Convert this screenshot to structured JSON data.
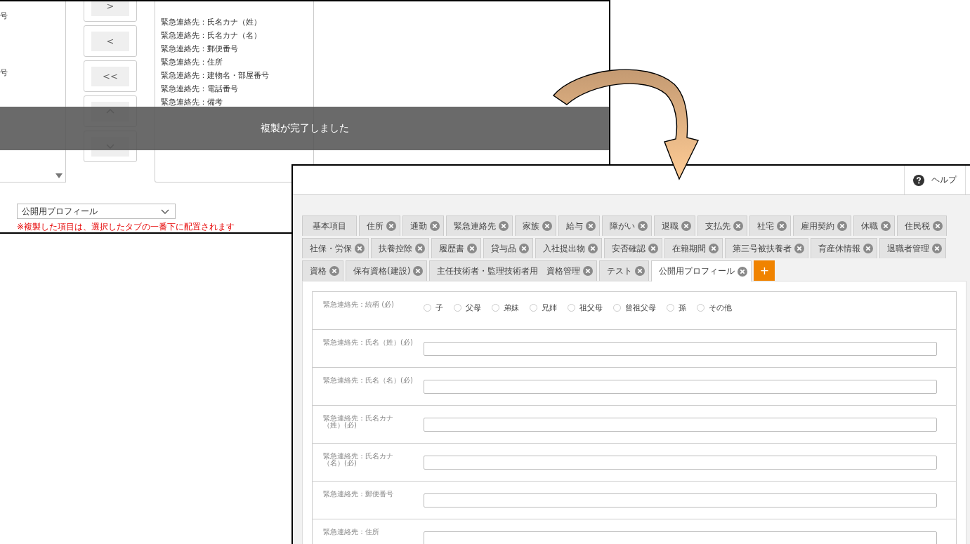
{
  "copy_window": {
    "source_list": {
      "items": [
        "号",
        "号"
      ]
    },
    "move_buttons": [
      {
        "kind": "text",
        "label": ">"
      },
      {
        "kind": "text",
        "label": "<"
      },
      {
        "kind": "text",
        "label": "<<"
      },
      {
        "kind": "up"
      },
      {
        "kind": "down"
      }
    ],
    "target_list": {
      "items": [
        "緊急連絡先：氏名カナ（姓）",
        "緊急連絡先：氏名カナ（名）",
        "緊急連絡先：郵便番号",
        "緊急連絡先：住所",
        "緊急連絡先：建物名・部屋番号",
        "緊急連絡先：電話番号",
        "緊急連絡先：備考"
      ]
    },
    "target_tab_select": {
      "value": "公開用プロフィール"
    },
    "note": "※複製した項目は、選択したタブの一番下に配置されます",
    "toast": {
      "message": "複製が完了しました"
    }
  },
  "form_window": {
    "help": "ヘルプ",
    "tab_rows": [
      [
        {
          "label": "基本項目",
          "closable": false,
          "selected": false
        },
        {
          "label": "住所",
          "closable": true,
          "selected": false
        },
        {
          "label": "通勤",
          "closable": true,
          "selected": false
        },
        {
          "label": "緊急連絡先",
          "closable": true,
          "selected": false
        },
        {
          "label": "家族",
          "closable": true,
          "selected": false
        },
        {
          "label": "給与",
          "closable": true,
          "selected": false
        },
        {
          "label": "障がい",
          "closable": true,
          "selected": false
        },
        {
          "label": "退職",
          "closable": true,
          "selected": false
        },
        {
          "label": "支払先",
          "closable": true,
          "selected": false
        },
        {
          "label": "社宅",
          "closable": true,
          "selected": false
        },
        {
          "label": "雇用契約",
          "closable": true,
          "selected": false
        },
        {
          "label": "休職",
          "closable": true,
          "selected": false
        },
        {
          "label": "住民税",
          "closable": true,
          "selected": false
        }
      ],
      [
        {
          "label": "社保・労保",
          "closable": true,
          "selected": false
        },
        {
          "label": "扶養控除",
          "closable": true,
          "selected": false
        },
        {
          "label": "履歴書",
          "closable": true,
          "selected": false
        },
        {
          "label": "貸与品",
          "closable": true,
          "selected": false
        },
        {
          "label": "入社提出物",
          "closable": true,
          "selected": false
        },
        {
          "label": "安否確認",
          "closable": true,
          "selected": false
        },
        {
          "label": "在籍期間",
          "closable": true,
          "selected": false
        },
        {
          "label": "第三号被扶養者",
          "closable": true,
          "selected": false
        },
        {
          "label": "育産休情報",
          "closable": true,
          "selected": false
        },
        {
          "label": "退職者管理",
          "closable": true,
          "selected": false
        }
      ],
      [
        {
          "label": "資格",
          "closable": true,
          "selected": false
        },
        {
          "label": "保有資格(建設)",
          "closable": true,
          "selected": false
        },
        {
          "label": "主任技術者・監理技術者用　資格管理",
          "closable": true,
          "selected": false
        },
        {
          "label": "テスト",
          "closable": true,
          "selected": false
        },
        {
          "label": "公開用プロフィール",
          "closable": true,
          "selected": true
        }
      ]
    ],
    "add_tab": "+",
    "fields": [
      {
        "kind": "radio",
        "label": "緊急連絡先：続柄 (必)",
        "options": [
          {
            "label": "子",
            "selected": false
          },
          {
            "label": "父母",
            "selected": false
          },
          {
            "label": "弟妹",
            "selected": false
          },
          {
            "label": "兄姉",
            "selected": false
          },
          {
            "label": "祖父母",
            "selected": false
          },
          {
            "label": "曾祖父母",
            "selected": false
          },
          {
            "label": "孫",
            "selected": false
          },
          {
            "label": "その他",
            "selected": false
          }
        ]
      },
      {
        "kind": "text",
        "label": "緊急連絡先：氏名（姓）(必)"
      },
      {
        "kind": "text",
        "label": "緊急連絡先：氏名（名）(必)"
      },
      {
        "kind": "text",
        "label": "緊急連絡先：氏名カナ（姓）(必)"
      },
      {
        "kind": "text",
        "label": "緊急連絡先：氏名カナ（名）(必)"
      },
      {
        "kind": "text",
        "label": "緊急連絡先：郵便番号"
      },
      {
        "kind": "text",
        "label": "緊急連絡先：住所"
      }
    ]
  }
}
